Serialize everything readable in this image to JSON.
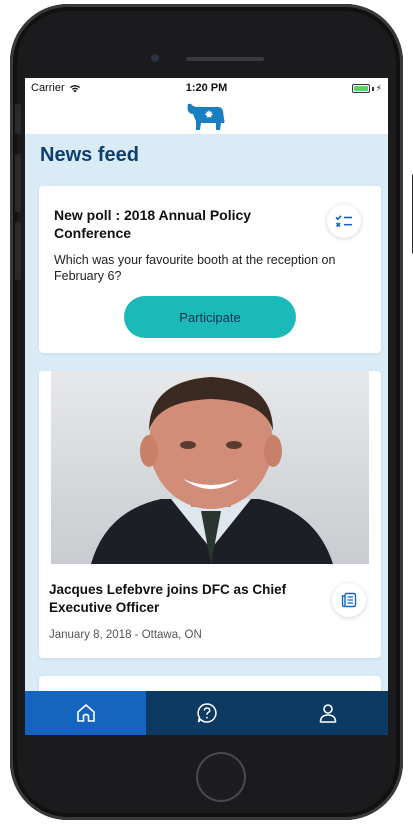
{
  "status_bar": {
    "carrier": "Carrier",
    "time": "1:20 PM",
    "wifi_icon": "wifi-icon",
    "battery_icon": "battery-icon",
    "charging_icon": "charging-bolt-icon"
  },
  "header": {
    "logo_icon": "cow-maple-leaf-logo"
  },
  "page": {
    "title": "News feed"
  },
  "poll_card": {
    "title": "New poll : 2018 Annual Policy Conference",
    "description": "Which was your favourite booth at the reception on February 6?",
    "button_label": "Participate",
    "icon": "poll-checklist-icon"
  },
  "news_card": {
    "image": "portrait-photo",
    "title": "Jacques Lefebvre joins DFC as Chief Executive Officer",
    "meta": "January 8, 2018 - Ottawa, ON",
    "icon": "article-icon"
  },
  "tab_bar": {
    "tabs": [
      {
        "icon": "home-icon",
        "active": true
      },
      {
        "icon": "help-circle-icon",
        "active": false
      },
      {
        "icon": "user-icon",
        "active": false
      }
    ]
  },
  "colors": {
    "background": "#d8ebf7",
    "title": "#0f3f6f",
    "accent_button": "#1bbab8",
    "tab_bar": "#0d3a62",
    "tab_active": "#1565c0",
    "logo": "#1a7fc1"
  }
}
